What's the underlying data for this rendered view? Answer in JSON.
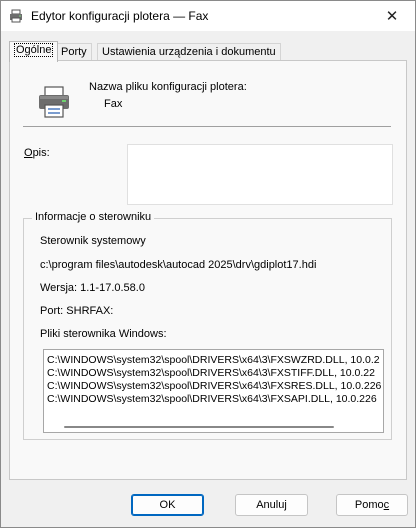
{
  "window": {
    "title": "Edytor konfiguracji plotera — Fax"
  },
  "tabs": [
    {
      "label": "Ogólne"
    },
    {
      "label": "Porty"
    },
    {
      "label": "Ustawienia urządzenia i dokumentu"
    }
  ],
  "general": {
    "name_label": "Nazwa pliku konfiguracji plotera:",
    "name_value": "Fax",
    "description_label": "Opis:",
    "description_value": "",
    "driver_group": {
      "legend": "Informacje o sterowniku",
      "driver_type": "Sterownik systemowy",
      "driver_path": "c:\\program files\\autodesk\\autocad 2025\\drv\\gdiplot17.hdi",
      "version": "Wersja: 1.1-17.0.58.0",
      "port": "Port: SHRFAX:",
      "files_label": "Pliki sterownika Windows:",
      "files": [
        "C:\\WINDOWS\\system32\\spool\\DRIVERS\\x64\\3\\FXSWZRD.DLL, 10.0.2",
        "C:\\WINDOWS\\system32\\spool\\DRIVERS\\x64\\3\\FXSTIFF.DLL, 10.0.22",
        "C:\\WINDOWS\\system32\\spool\\DRIVERS\\x64\\3\\FXSRES.DLL, 10.0.226",
        "C:\\WINDOWS\\system32\\spool\\DRIVERS\\x64\\3\\FXSAPI.DLL, 10.0.226"
      ]
    }
  },
  "buttons": {
    "ok": "OK",
    "cancel": "Anuluj",
    "help": "Pomoc"
  },
  "colors": {
    "accent": "#0067c0",
    "panel": "#f9f9f9",
    "window": "#f0f0f0"
  }
}
